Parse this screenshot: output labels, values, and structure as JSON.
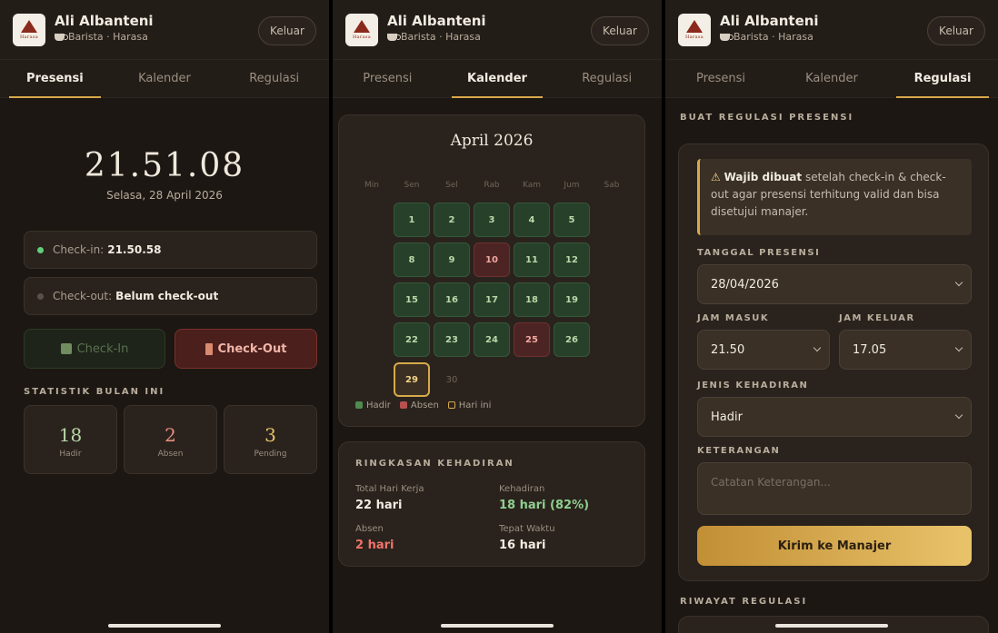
{
  "user": {
    "name": "Ali Albanteni",
    "role": "Barista · Harasa",
    "logo_text": "Harasa",
    "logout_label": "Keluar"
  },
  "tabs": [
    "Presensi",
    "Kalender",
    "Regulasi"
  ],
  "presensi": {
    "clock": "21.51.08",
    "date": "Selasa, 28 April 2026",
    "checkin_label": "Check-in:",
    "checkin_value": "21.50.58",
    "checkout_label": "Check-out:",
    "checkout_value": "Belum check-out",
    "btn_checkin": "Check-In",
    "btn_checkout": "Check-Out",
    "stats_title": "STATISTIK BULAN INI",
    "stats": [
      {
        "value": "18",
        "label": "Hadir",
        "color": "#b8d8a8"
      },
      {
        "value": "2",
        "label": "Absen",
        "color": "#e88f80"
      },
      {
        "value": "3",
        "label": "Pending",
        "color": "#e9c36a"
      }
    ]
  },
  "kalender": {
    "month": "April 2026",
    "weekdays": [
      "Min",
      "Sen",
      "Sel",
      "Rab",
      "Kam",
      "Jum",
      "Sab"
    ],
    "weeks": [
      [
        null,
        {
          "d": "1",
          "s": "h"
        },
        {
          "d": "2",
          "s": "h"
        },
        {
          "d": "3",
          "s": "h"
        },
        {
          "d": "4",
          "s": "h"
        },
        {
          "d": "5",
          "s": "h"
        },
        null
      ],
      [
        null,
        {
          "d": "8",
          "s": "h"
        },
        {
          "d": "9",
          "s": "h"
        },
        {
          "d": "10",
          "s": "a"
        },
        {
          "d": "11",
          "s": "h"
        },
        {
          "d": "12",
          "s": "h"
        },
        null
      ],
      [
        null,
        {
          "d": "15",
          "s": "h"
        },
        {
          "d": "16",
          "s": "h"
        },
        {
          "d": "17",
          "s": "h"
        },
        {
          "d": "18",
          "s": "h"
        },
        {
          "d": "19",
          "s": "h"
        },
        null
      ],
      [
        null,
        {
          "d": "22",
          "s": "h"
        },
        {
          "d": "23",
          "s": "h"
        },
        {
          "d": "24",
          "s": "h"
        },
        {
          "d": "25",
          "s": "a"
        },
        {
          "d": "26",
          "s": "h"
        },
        null
      ],
      [
        null,
        {
          "d": "29",
          "s": "t"
        },
        {
          "d": "30",
          "s": "f"
        },
        null,
        null,
        null,
        null
      ]
    ],
    "legend": [
      "Hadir",
      "Absen",
      "Hari ini"
    ],
    "legend_colors": [
      "#4f8a4f",
      "#b85050",
      "#d8a94a"
    ],
    "summary_title": "RINGKASAN KEHADIRAN",
    "summary": [
      {
        "label": "Total Hari Kerja",
        "value": "22 hari",
        "color": "#f1ebe1"
      },
      {
        "label": "Kehadiran",
        "value": "18 hari (82%)",
        "color": "#8fd08f"
      },
      {
        "label": "Absen",
        "value": "2 hari",
        "color": "#f0736a"
      },
      {
        "label": "Tepat Waktu",
        "value": "16 hari",
        "color": "#f1ebe1"
      }
    ]
  },
  "regulasi": {
    "section_title": "BUAT REGULASI PRESENSI",
    "warning_bold": "Wajib dibuat",
    "warning_text": " setelah check-in & check-out agar presensi terhitung valid dan bisa disetujui manajer.",
    "date_label": "TANGGAL PRESENSI",
    "date_value": "28/04/2026",
    "in_label": "JAM MASUK",
    "in_value": "21.50",
    "out_label": "JAM KELUAR",
    "out_value": "17.05",
    "type_label": "JENIS KEHADIRAN",
    "type_value": "Hadir",
    "note_label": "KETERANGAN",
    "note_placeholder": "Catatan Keterangan...",
    "submit_label": "Kirim ke Manajer",
    "history_title": "RIWAYAT REGULASI"
  }
}
